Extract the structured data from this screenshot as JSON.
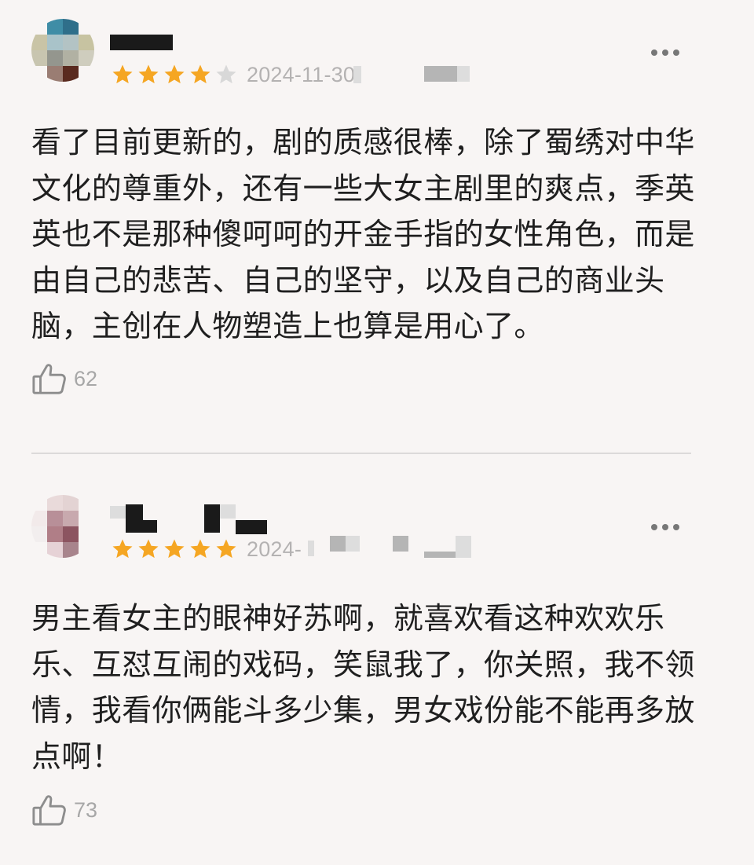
{
  "colors": {
    "star_filled": "#f5a623",
    "star_empty": "#d8d8d8",
    "date": "#b4b2b2",
    "text": "#1f1f1f",
    "like": "#a7a7a7"
  },
  "reviews": [
    {
      "username": "",
      "rating": 4,
      "rating_max": 5,
      "date": "2024-11-30",
      "content": "看了目前更新的，剧的质感很棒，除了蜀绣对中华文化的尊重外，还有一些大女主剧里的爽点，季英英也不是那种傻呵呵的开金手指的女性角色，而是由自己的悲苦、自己的坚守，以及自己的商业头脑，主创在人物塑造上也算是用心了。",
      "like_icon": "thumbs-up-icon",
      "likes": "62",
      "more_icon": "more-icon"
    },
    {
      "username": "",
      "rating": 5,
      "rating_max": 5,
      "date": "2024-",
      "content": "男主看女主的眼神好苏啊，就喜欢看这种欢欢乐乐、互怼互闹的戏码，笑鼠我了，你关照，我不领情，我看你俩能斗多少集，男女戏份能不能再多放点啊！",
      "like_icon": "thumbs-up-icon",
      "likes": "73",
      "more_icon": "more-icon"
    }
  ]
}
